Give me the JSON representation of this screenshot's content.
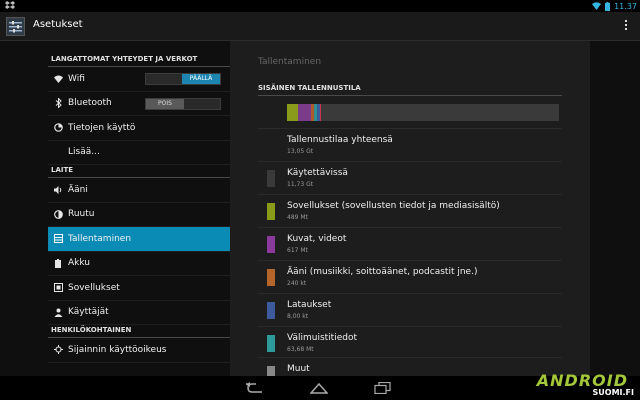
{
  "status_bar": {
    "time": "11.37"
  },
  "action_bar": {
    "title": "Asetukset"
  },
  "sidebar": {
    "sections": [
      {
        "header": "LANGATTOMAT YHTEYDET JA VERKOT"
      },
      {
        "header": "LAITE"
      },
      {
        "header": "HENKILÖKOHTAINEN"
      }
    ],
    "items": [
      {
        "label": "Wifi",
        "icon": "wifi-icon",
        "toggle": "PÄÄLLÄ"
      },
      {
        "label": "Bluetooth",
        "icon": "bluetooth-icon",
        "toggle": "POIS"
      },
      {
        "label": "Tietojen käyttö",
        "icon": "data-usage-icon"
      },
      {
        "label": "Lisää..."
      },
      {
        "label": "Ääni",
        "icon": "volume-icon"
      },
      {
        "label": "Ruutu",
        "icon": "display-icon"
      },
      {
        "label": "Tallentaminen",
        "icon": "storage-icon",
        "selected": true
      },
      {
        "label": "Akku",
        "icon": "battery-icon"
      },
      {
        "label": "Sovellukset",
        "icon": "apps-icon"
      },
      {
        "label": "Käyttäjät",
        "icon": "users-icon"
      },
      {
        "label": "Sijainnin käyttöoikeus",
        "icon": "location-icon"
      }
    ]
  },
  "detail": {
    "title": "Tallentaminen",
    "section": "SISÄINEN TALLENNUSTILA",
    "usage_segments": [
      {
        "color": "#8a9a1b",
        "fraction": 0.04
      },
      {
        "color": "#7b3c8c",
        "fraction": 0.05
      },
      {
        "color": "#b05a2a",
        "fraction": 0.01
      },
      {
        "color": "#2d8f8f",
        "fraction": 0.01
      },
      {
        "color": "#3b5a9a",
        "fraction": 0.01
      },
      {
        "color": "#cc3344",
        "fraction": 0.005
      }
    ],
    "rows": [
      {
        "name": "Tallennustilaa yhteensä",
        "size": "13,05 Gt",
        "color": ""
      },
      {
        "name": "Käytettävissä",
        "size": "11,73 Gt",
        "color": "#3a3a3a"
      },
      {
        "name": "Sovellukset (sovellusten tiedot ja mediasisältö)",
        "size": "489 Mt",
        "color": "#8a9a1b"
      },
      {
        "name": "Kuvat, videot",
        "size": "617 Mt",
        "color": "#8a3a9a"
      },
      {
        "name": "Ääni (musiikki, soittoäänet, podcastit jne.)",
        "size": "240 kt",
        "color": "#b5652a"
      },
      {
        "name": "Lataukset",
        "size": "8,00 kt",
        "color": "#3c5a9c"
      },
      {
        "name": "Välimuistitiedot",
        "size": "63,68 Mt",
        "color": "#2f9a9a"
      },
      {
        "name": "Muut",
        "size": "",
        "color": "#888888"
      }
    ]
  },
  "watermark": {
    "brand": "ANDROID",
    "site": "SUOMI.FI"
  }
}
